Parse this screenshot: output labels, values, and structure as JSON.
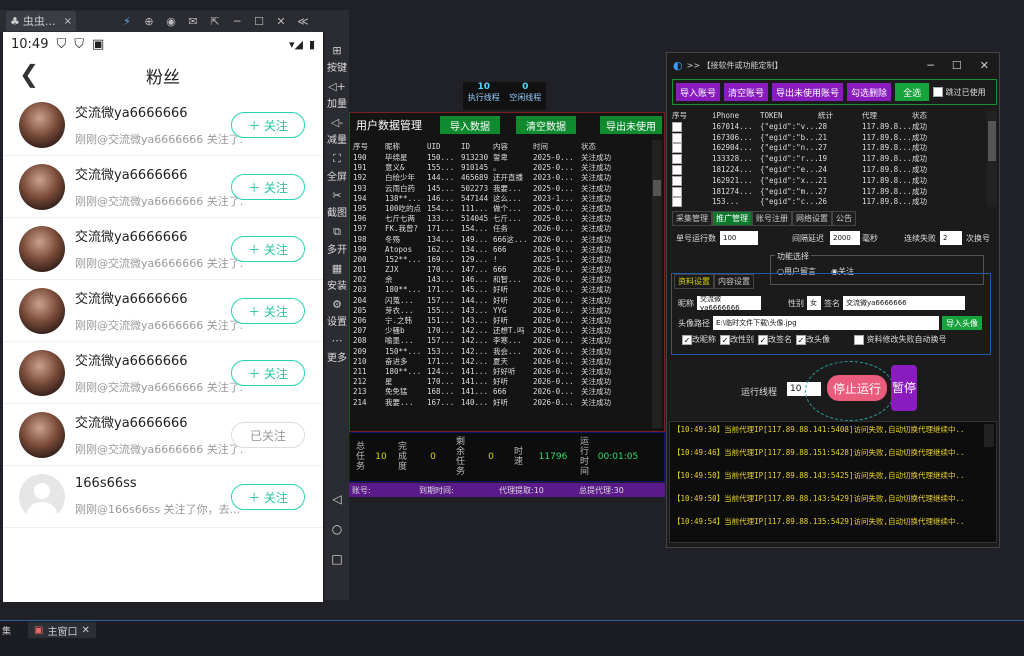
{
  "emulator": {
    "tab_label": "虫虫...",
    "tab_close": "×",
    "win_controls": [
      "─",
      "☐",
      "✕",
      "≪"
    ]
  },
  "phone": {
    "status_time": "10:49",
    "status_icons": [
      "▾◢",
      "▮"
    ],
    "header_title": "粉丝",
    "back": "❮",
    "fans": [
      {
        "name": "交流微ya6666666",
        "desc": "刚刚@交流微ya6666666 关注了...",
        "button": "＋ 关注",
        "followed": false,
        "avatar": "photo"
      },
      {
        "name": "交流微ya6666666",
        "desc": "刚刚@交流微ya6666666 关注了...",
        "button": "＋ 关注",
        "followed": false,
        "avatar": "photo"
      },
      {
        "name": "交流微ya6666666",
        "desc": "刚刚@交流微ya6666666 关注了...",
        "button": "＋ 关注",
        "followed": false,
        "avatar": "photo"
      },
      {
        "name": "交流微ya6666666",
        "desc": "刚刚@交流微ya6666666 关注了...",
        "button": "＋ 关注",
        "followed": false,
        "avatar": "photo"
      },
      {
        "name": "交流微ya6666666",
        "desc": "刚刚@交流微ya6666666 关注了...",
        "button": "＋ 关注",
        "followed": false,
        "avatar": "photo"
      },
      {
        "name": "交流微ya6666666",
        "desc": "刚刚@交流微ya6666666 关注了...",
        "button": "已关注",
        "followed": true,
        "avatar": "photo"
      },
      {
        "name": "166s66ss",
        "desc": "刚刚@166s66ss 关注了你，去...",
        "button": "＋ 关注",
        "followed": false,
        "avatar": "default"
      }
    ]
  },
  "sidebar": [
    {
      "icon": "⊞",
      "label": "按键"
    },
    {
      "icon": "◁+",
      "label": "加量"
    },
    {
      "icon": "◁-",
      "label": "减量"
    },
    {
      "icon": "⛶",
      "label": "全屏"
    },
    {
      "icon": "✂",
      "label": "截图"
    },
    {
      "icon": "⧉",
      "label": "多开"
    },
    {
      "icon": "▦",
      "label": "安装"
    },
    {
      "icon": "⚙",
      "label": "设置"
    },
    {
      "icon": "⋯",
      "label": "更多"
    }
  ],
  "nav_buttons": [
    "◁",
    "○",
    "□"
  ],
  "taskbar": {
    "left_text": "集",
    "tab_label": "主窗口",
    "tab_close": "✕"
  },
  "mid_app": {
    "top_stats": [
      {
        "value": "10",
        "label": "执行线程"
      },
      {
        "value": "0",
        "label": "空闲线程"
      }
    ],
    "title": "用户数据管理",
    "buttons": [
      "导入数据",
      "清空数据",
      "导出未使用"
    ],
    "columns": [
      "序号",
      "昵称",
      "UID",
      "ID",
      "内容",
      "时间",
      "状态"
    ],
    "rows": [
      [
        "190",
        "毕绵星",
        "150...",
        "913230",
        "誓卑",
        "2025-0...",
        "关注成功"
      ],
      [
        "191",
        "意义&",
        "155...",
        "910145",
        "。",
        "2025-0...",
        "关注成功"
      ],
      [
        "192",
        "白绘少年",
        "144...",
        "465689",
        "还开直播",
        "2023-0...",
        "关注成功"
      ],
      [
        "193",
        "云雨白药",
        "145...",
        "502273",
        "我要...",
        "2025-0...",
        "关注成功"
      ],
      [
        "194",
        "138**...",
        "146...",
        "547144",
        "这么...",
        "2023-1...",
        "关注成功"
      ],
      [
        "195",
        "100吃的点",
        "154...",
        "111...",
        "做个...",
        "2025-0...",
        "关注成功"
      ],
      [
        "196",
        "七斤七两",
        "133...",
        "514045",
        "七斤...",
        "2025-0...",
        "关注成功"
      ],
      [
        "197",
        "FK.我曾?",
        "171...",
        "154...",
        "任务",
        "2026-0...",
        "关注成功"
      ],
      [
        "198",
        "冬殇",
        "134...",
        "149...",
        "666这...",
        "2026-0...",
        "关注成功"
      ],
      [
        "199",
        "Atopos",
        "162...",
        "134...",
        "666",
        "2026-0...",
        "关注成功"
      ],
      [
        "200",
        "152**...",
        "169...",
        "129...",
        "!",
        "2025-1...",
        "关注成功"
      ],
      [
        "201",
        "ZJX",
        "170...",
        "147...",
        "666",
        "2026-0...",
        "关注成功"
      ],
      [
        "202",
        "余",
        "143...",
        "146...",
        "和智...",
        "2026-0...",
        "关注成功"
      ],
      [
        "203",
        "180**...",
        "171...",
        "145...",
        "好听",
        "2026-0...",
        "关注成功"
      ],
      [
        "204",
        "闪蒐...",
        "157...",
        "144...",
        "好听",
        "2026-0...",
        "关注成功"
      ],
      [
        "205",
        "芽衣...",
        "155...",
        "143...",
        "YYG",
        "2026-0...",
        "关注成功"
      ],
      [
        "206",
        "宁.之韩",
        "151...",
        "143...",
        "好听",
        "2026-0...",
        "关注成功"
      ],
      [
        "207",
        "少骚b",
        "170...",
        "142...",
        "还想T.吗",
        "2026-0...",
        "关注成功"
      ],
      [
        "208",
        "喻墨...",
        "157...",
        "142...",
        "李寒...",
        "2026-0...",
        "关注成功"
      ],
      [
        "209",
        "150**...",
        "153...",
        "142...",
        "我会...",
        "2026-0...",
        "关注成功"
      ],
      [
        "210",
        "奋进多",
        "171...",
        "142...",
        "夏天",
        "2026-0...",
        "关注成功"
      ],
      [
        "211",
        "180**...",
        "124...",
        "141...",
        "好好听",
        "2026-0...",
        "关注成功"
      ],
      [
        "212",
        "星",
        "170...",
        "141...",
        "好听",
        "2026-0...",
        "关注成功"
      ],
      [
        "213",
        "免免猛",
        "168...",
        "141...",
        "666",
        "2026-0...",
        "关注成功"
      ],
      [
        "214",
        "我要...",
        "167...",
        "140...",
        "好听",
        "2026-0...",
        "关注成功"
      ]
    ],
    "stats": {
      "total_label": "总任务",
      "total": "10",
      "done_label": "完成度",
      "done": "0",
      "remain_label": "剩余任务",
      "remain": "0",
      "speed_label": "时速",
      "speed": "11796",
      "runtime_label": "运行时间",
      "runtime": "00:01:05"
    },
    "footer": {
      "account": "账号:",
      "expire": "到期时间:",
      "proxy_fetch": "代理提取:10",
      "proxy_total": "总提代理:30"
    }
  },
  "right_app": {
    "title": ">> 【接软件或功能定制】",
    "buttons": [
      "导入账号",
      "清空账号",
      "导出未使用账号",
      "勾选删除",
      "全选"
    ],
    "skip_used": "跳过已使用",
    "columns": [
      "序号",
      "iPhone",
      "TOKEN",
      "統计",
      "代理",
      "状态"
    ],
    "rows": [
      [
        "1",
        "167014...",
        "{\"egid\":\"v...",
        "28",
        "117.89.8...",
        "成功"
      ],
      [
        "2",
        "167306...",
        "{\"egid\":\"b...",
        "21",
        "117.89.8...",
        "成功"
      ],
      [
        "3",
        "162904...",
        "{\"egid\":\"n...",
        "27",
        "117.89.8...",
        "成功"
      ],
      [
        "4",
        "133328...",
        "{\"egid\":\"r...",
        "19",
        "117.89.8...",
        "成功"
      ],
      [
        "5",
        "181224...",
        "{\"egid\":\"e...",
        "24",
        "117.89.8...",
        "成功"
      ],
      [
        "6",
        "162921...",
        "{\"egid\":\"x...",
        "21",
        "117.89.8...",
        "成功"
      ],
      [
        "7",
        "181274...",
        "{\"egid\":\"m...",
        "27",
        "117.89.8...",
        "成功"
      ],
      [
        "8",
        "153...",
        "{\"egid\":\"c...",
        "26",
        "117.89.8...",
        "成功"
      ]
    ],
    "tabs": [
      "采集管理",
      "推广管理",
      "账号注册",
      "网络设置",
      "公告"
    ],
    "single_run_label": "单号运行数",
    "single_run": "100",
    "interval_label": "间隔延迟",
    "interval": "2000",
    "ms": "毫秒",
    "fail_label": "连续失败",
    "fail": "2",
    "switch": "次换号",
    "func_label": "功能选择",
    "radio_msg": "用户留言",
    "radio_follow": "关注",
    "subtabs": [
      "资料设置",
      "内容设置"
    ],
    "nick_label": "昵称",
    "nick": "交流微ya6666666",
    "gender_label": "性别",
    "gender": "女",
    "sign_label": "签名",
    "sign": "交流微ya6666666",
    "avatar_label": "头像路径",
    "avatar_path": "E:\\临时文件下载\\头像.jpg",
    "import_avatar": "导入头像",
    "checks": [
      "改昵称",
      "改性别",
      "改签名",
      "改头像"
    ],
    "auto_switch": "资料修改失败自动换号",
    "threads_label": "运行线程",
    "threads": "10",
    "stop": "停止运行",
    "pause": "暂停",
    "logs": [
      "【10:49:30】当前代理IP[117.89.88.141:5408]访问失败,自动切换代理继续中..",
      "【10:49:46】当前代理IP[117.89.88.151:5428]访问失败,自动切换代理继续中..",
      "【10:49:50】当前代理IP[117.89.88.143:5425]访问失败,自动切换代理继续中..",
      "【10:49:50】当前代理IP[117.89.88.143:5429]访问失败,自动切换代理继续中..",
      "【10:49:54】当前代理IP[117.89.88.135:5429]访问失败,自动切换代理继续中.."
    ]
  }
}
